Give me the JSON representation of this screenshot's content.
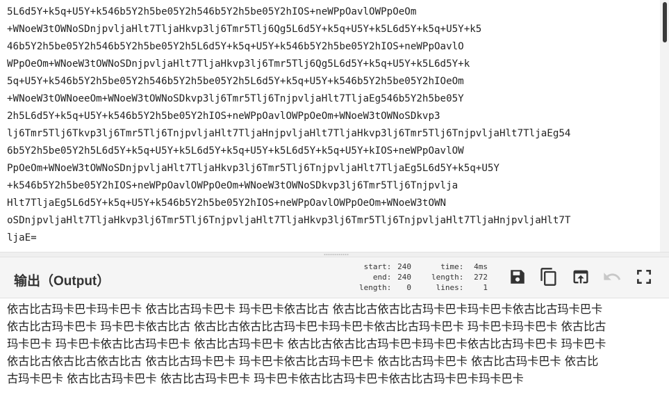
{
  "input": {
    "lines": [
      "5L6d5Y+k5q+U5Y+k546b5Y2h5be05Y2h546b5Y2h5be05Y2hIOS+neWPpOavlOWPpOeOm",
      "+WNoeW3tOWNoSDnjpvljaHlt7TljaHkvp3lj6Tmr5Tlj6Qg5L6d5Y+k5q+U5Y+k5L6d5Y+k5q+U5Y+k5",
      "46b5Y2h5be05Y2h546b5Y2h5be05Y2h5L6d5Y+k5q+U5Y+k546b5Y2h5be05Y2hIOS+neWPpOavlO",
      "WPpOeOm+WNoeW3tOWNoSDnjpvljaHlt7TljaHkvp3lj6Tmr5Tlj6Qg5L6d5Y+k5q+U5Y+k5L6d5Y+k",
      "5q+U5Y+k546b5Y2h5be05Y2h546b5Y2h5be05Y2h5L6d5Y+k5q+U5Y+k546b5Y2h5be05Y2hIOeOm",
      "+WNoeW3tOWNoeeOm+WNoeW3tOWNoSDkvp3lj6Tmr5Tlj6TnjpvljaHlt7TljaEg546b5Y2h5be05Y",
      "2h5L6d5Y+k5q+U5Y+k546b5Y2h5be05Y2hIOS+neWPpOavlOWPpOeOm+WNoeW3tOWNoSDkvp3",
      "lj6Tmr5Tlj6Tkvp3lj6Tmr5Tlj6TnjpvljaHlt7TljaHnjpvljaHlt7TljaHkvp3lj6Tmr5Tlj6TnjpvljaHlt7TljaEg54",
      "6b5Y2h5be05Y2h5L6d5Y+k5q+U5Y+k5L6d5Y+k5q+U5Y+k5L6d5Y+k5q+U5Y+kIOS+neWPpOavlOW",
      "PpOeOm+WNoeW3tOWNoSDnjpvljaHlt7TljaHkvp3lj6Tmr5Tlj6TnjpvljaHlt7TljaEg5L6d5Y+k5q+U5Y",
      "+k546b5Y2h5be05Y2hIOS+neWPpOavlOWPpOeOm+WNoeW3tOWNoSDkvp3lj6Tmr5Tlj6Tnjpvlja",
      "Hlt7TljaEg5L6d5Y+k5q+U5Y+k546b5Y2h5be05Y2hIOS+neWPpOavlOWPpOeOm+WNoeW3tOWN",
      "oSDnjpvljaHlt7TljaHkvp3lj6Tmr5Tlj6TnjpvljaHlt7TljaHkvp3lj6Tmr5Tlj6TnjpvljaHlt7TljaHnjpvljaHlt7T",
      "ljaE="
    ]
  },
  "output": {
    "title": "输出（Output）",
    "stats": {
      "start_label": "start:",
      "start": "240",
      "end_label": "end:",
      "end": "240",
      "length_label": "length:",
      "length": "0",
      "time_label": "time:",
      "time": "4ms",
      "total_length_label": "length:",
      "total_length": "272",
      "lines_label": "lines:",
      "lines": "1"
    },
    "lines": [
      "依古比古玛卡巴卡玛卡巴卡 依古比古玛卡巴卡 玛卡巴卡依古比古 依古比古依古比古玛卡巴卡玛卡巴卡依古比古玛卡巴卡",
      "依古比古玛卡巴卡 玛卡巴卡依古比古 依古比古依古比古玛卡巴卡玛卡巴卡依古比古玛卡巴卡 玛卡巴卡玛卡巴卡 依古比古",
      "玛卡巴卡 玛卡巴卡依古比古玛卡巴卡 依古比古玛卡巴卡 依古比古依古比古玛卡巴卡玛卡巴卡依古比古玛卡巴卡 玛卡巴卡",
      "依古比古依古比古依古比古 依古比古玛卡巴卡 玛卡巴卡依古比古玛卡巴卡 依古比古玛卡巴卡 依古比古玛卡巴卡 依古比",
      "古玛卡巴卡 依古比古玛卡巴卡 依古比古玛卡巴卡 玛卡巴卡依古比古玛卡巴卡依古比古玛卡巴卡玛卡巴卡"
    ]
  },
  "icons": {
    "save": "save-icon",
    "copy": "copy-icon",
    "replace_input": "replace-input-icon",
    "undo": "undo-icon",
    "maximize": "maximize-icon"
  },
  "colors": {
    "text": "#222222",
    "header_bg": "#f5f5f5",
    "icon": "#333333",
    "icon_disabled": "#c8c8c8",
    "scroll_thumb": "#3a3a3a"
  }
}
